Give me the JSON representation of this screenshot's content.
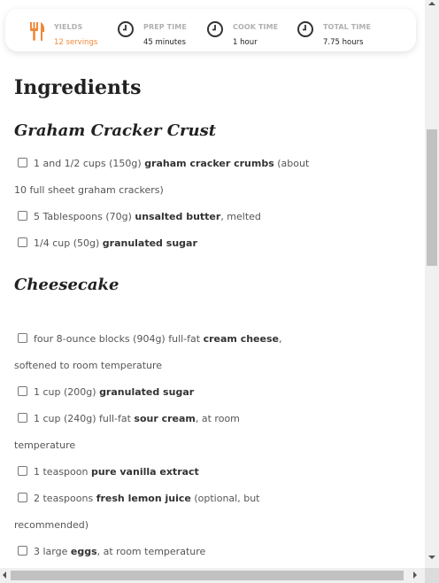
{
  "meta": {
    "yields_label": "YIELDS",
    "yields_value": "12 servings",
    "prep_label": "PREP TIME",
    "prep_value": "45 minutes",
    "cook_label": "COOK TIME",
    "cook_value": "1 hour",
    "total_label": "TOTAL TIME",
    "total_value": "7.75 hours",
    "accent_color": "#f0883a",
    "yields_icon": "fork-knife-icon",
    "time_icon": "clock-icon"
  },
  "ingredients_heading": "Ingredients",
  "crust": {
    "heading": "Graham Cracker Crust",
    "items": [
      {
        "pre": "1 and 1/2 cups (150g) ",
        "bold": "graham cracker crumbs",
        "post": " (about",
        "line2": "10 full sheet graham crackers)"
      },
      {
        "pre": "5 Tablespoons (70g) ",
        "bold": "unsalted butter",
        "post": ", melted",
        "line2": ""
      },
      {
        "pre": "1/4 cup (50g) ",
        "bold": "granulated sugar",
        "post": "",
        "line2": ""
      }
    ]
  },
  "cheesecake": {
    "heading": "Cheesecake",
    "items": [
      {
        "pre": "four 8-ounce blocks (904g) full-fat ",
        "bold": "cream cheese",
        "post": ",",
        "line2": "softened to room temperature"
      },
      {
        "pre": "1 cup (200g) ",
        "bold": "granulated sugar",
        "post": "",
        "line2": ""
      },
      {
        "pre": "1 cup (240g) full-fat ",
        "bold": "sour cream",
        "post": ", at room",
        "line2": "temperature"
      },
      {
        "pre": "1 teaspoon ",
        "bold": "pure vanilla extract",
        "post": "",
        "line2": ""
      },
      {
        "pre": "2 teaspoons ",
        "bold": "fresh lemon juice",
        "post": " (optional, but",
        "line2": "recommended)"
      },
      {
        "pre": "3 large ",
        "bold": "eggs",
        "post": ", at room temperature",
        "line2": ""
      }
    ]
  }
}
